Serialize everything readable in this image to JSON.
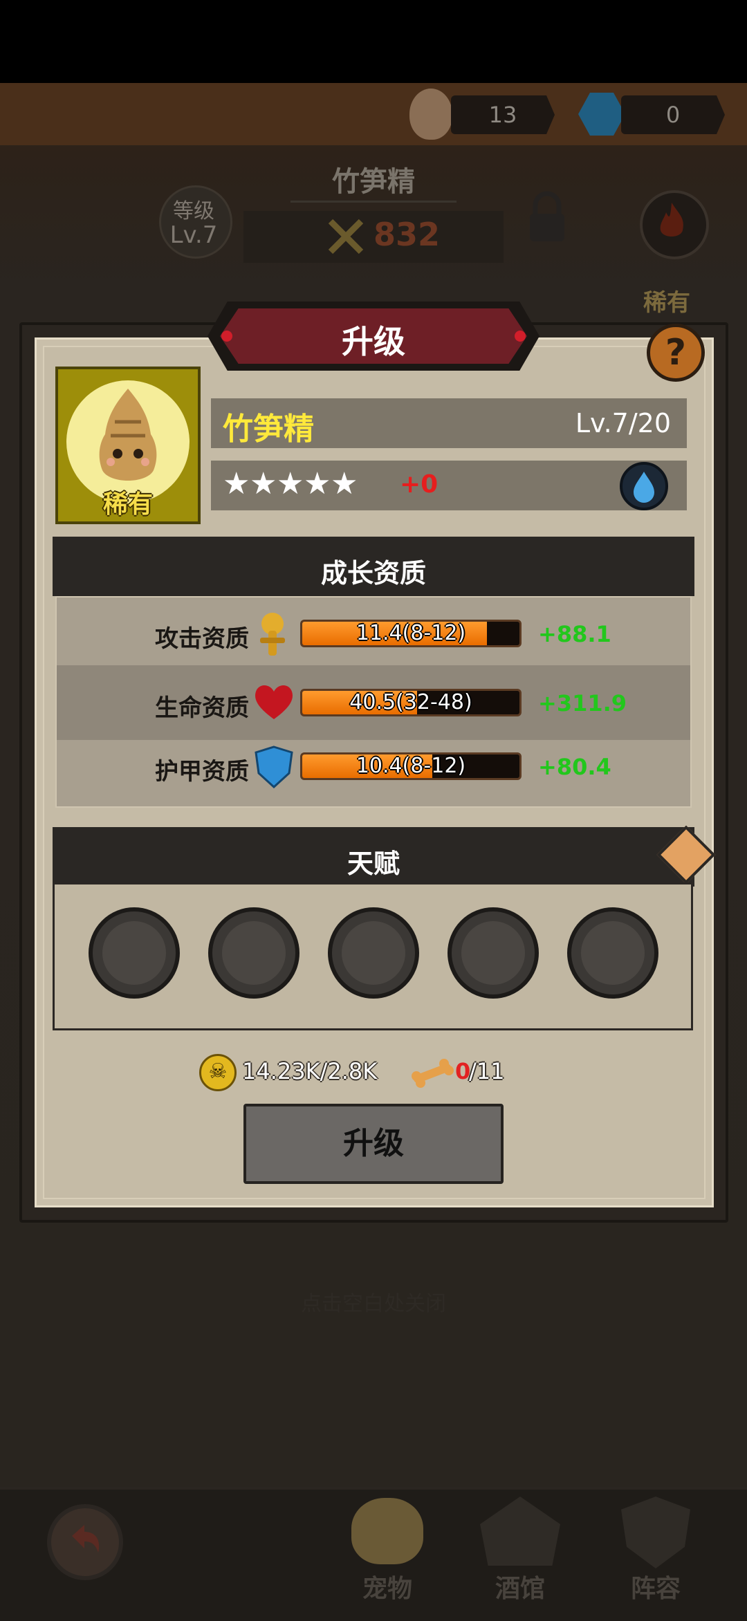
{
  "header": {
    "egg_count": "13",
    "gem_count": "0",
    "pet_name": "竹笋精",
    "level_label": "等级",
    "level_value": "Lv.7",
    "power": "832",
    "rarity": "稀有"
  },
  "modal": {
    "title": "升级",
    "help_icon": "question-icon",
    "pet": {
      "name": "竹笋精",
      "level": "Lv.7/20",
      "rarity": "稀有",
      "stars": 5,
      "star_bonus": "+0"
    },
    "growth": {
      "title": "成长资质",
      "stats": [
        {
          "label": "攻击资质",
          "value": "11.4(8-12)",
          "fill": 0.85,
          "bonus": "+88.1",
          "icon": "sword-icon"
        },
        {
          "label": "生命资质",
          "value": "40.5(32-48)",
          "fill": 0.53,
          "bonus": "+311.9",
          "icon": "heart-icon"
        },
        {
          "label": "护甲资质",
          "value": "10.4(8-12)",
          "fill": 0.6,
          "bonus": "+80.4",
          "icon": "shield-icon"
        }
      ]
    },
    "talent": {
      "title": "天赋",
      "slots": 5
    },
    "cost": {
      "gold": "14.23K/2.8K",
      "bone_have": "0",
      "bone_need": "/11"
    },
    "upgrade_button": "升级"
  },
  "hint": "点击空白处关闭",
  "nav": {
    "pets": "宠物",
    "tavern": "酒馆",
    "lineup": "阵容"
  },
  "colors": {
    "accent_gold": "#ffe93b",
    "bonus_green": "#22c71c",
    "bar_orange": "#ff8c1a",
    "title_red": "#6e1f26"
  }
}
